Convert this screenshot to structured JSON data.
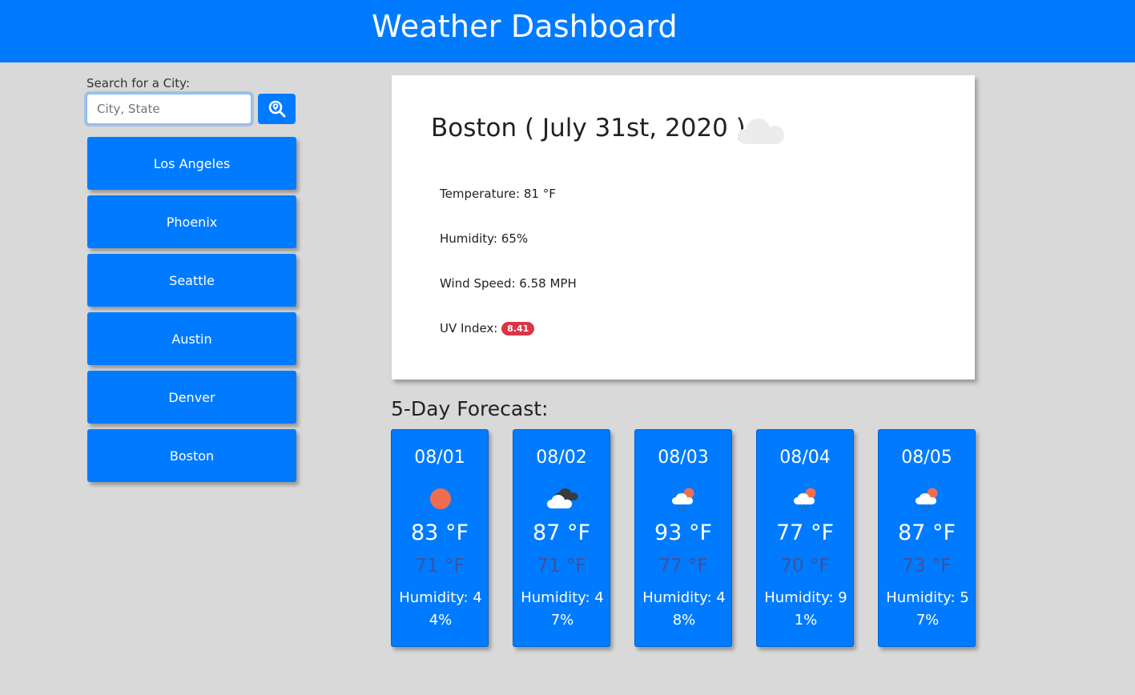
{
  "header": {
    "title": "Weather Dashboard"
  },
  "search": {
    "label": "Search for a City:",
    "placeholder": "City, State",
    "value": ""
  },
  "cities": [
    "Los Angeles",
    "Phoenix",
    "Seattle",
    "Austin",
    "Denver",
    "Boston"
  ],
  "current": {
    "title": "Boston ( July 31st, 2020 )",
    "icon": "cloud-icon",
    "temperature": "Temperature: 81 °F",
    "humidity": "Humidity: 65%",
    "wind": "Wind Speed: 6.58 MPH",
    "uv_label": "UV Index: ",
    "uv_value": "8.41"
  },
  "forecast": {
    "heading": "5-Day Forecast:",
    "days": [
      {
        "date": "08/01",
        "icon": "sun-icon",
        "high": "83 °F",
        "low": "71 °F",
        "humidity": "Humidity: 44%"
      },
      {
        "date": "08/02",
        "icon": "broken-clouds-icon",
        "high": "87 °F",
        "low": "71 °F",
        "humidity": "Humidity: 47%"
      },
      {
        "date": "08/03",
        "icon": "sun-rain-icon",
        "high": "93 °F",
        "low": "77 °F",
        "humidity": "Humidity: 48%"
      },
      {
        "date": "08/04",
        "icon": "sun-rain-icon",
        "high": "77 °F",
        "low": "70 °F",
        "humidity": "Humidity: 91%"
      },
      {
        "date": "08/05",
        "icon": "sun-rain-icon",
        "high": "87 °F",
        "low": "73 °F",
        "humidity": "Humidity: 57%"
      }
    ]
  },
  "colors": {
    "primary": "#007bff",
    "background": "#d9d9d9",
    "uv_badge": "#dc3545",
    "sun": "#ee6e4f"
  }
}
